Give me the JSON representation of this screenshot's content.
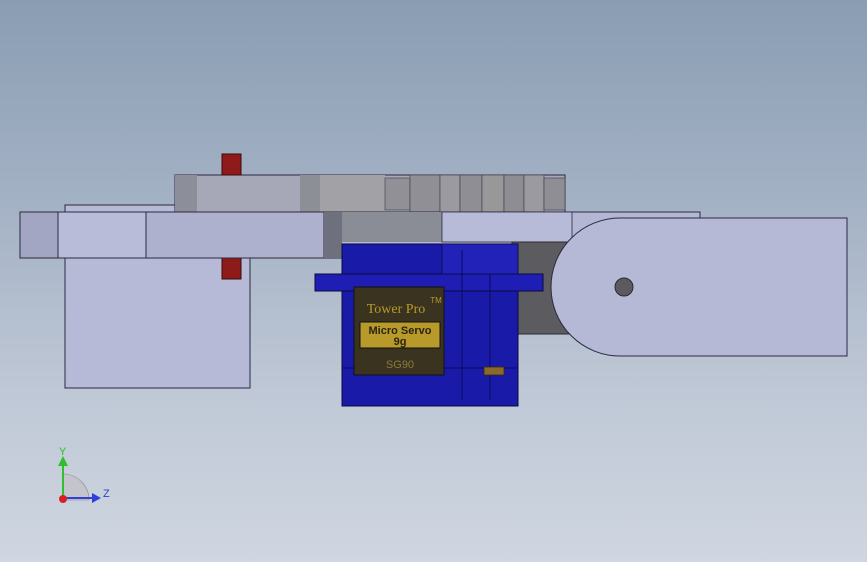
{
  "app": "SolidWorks 3D model viewport",
  "model": {
    "servo_brand": "Tower Pro",
    "servo_trademark": "TM",
    "servo_name_line1": "Micro Servo",
    "servo_name_line2": "9g",
    "servo_model": "SG90"
  },
  "triad": {
    "y_label": "Y",
    "z_label": "Z",
    "y_color": "#2fbf2f",
    "z_color": "#2f3fd8",
    "x_color": "#d81f1f"
  },
  "colors": {
    "servo_body": "#1a1aa8",
    "servo_label_bg": "#3a3320",
    "servo_label_gold": "#b89a2a",
    "pin_red": "#8e1a1a",
    "part_fill": "#b4b9d4",
    "part_edge": "#2a2a40",
    "gear_fill": "#9d9da3",
    "dark_gray": "#5a5a5e"
  }
}
